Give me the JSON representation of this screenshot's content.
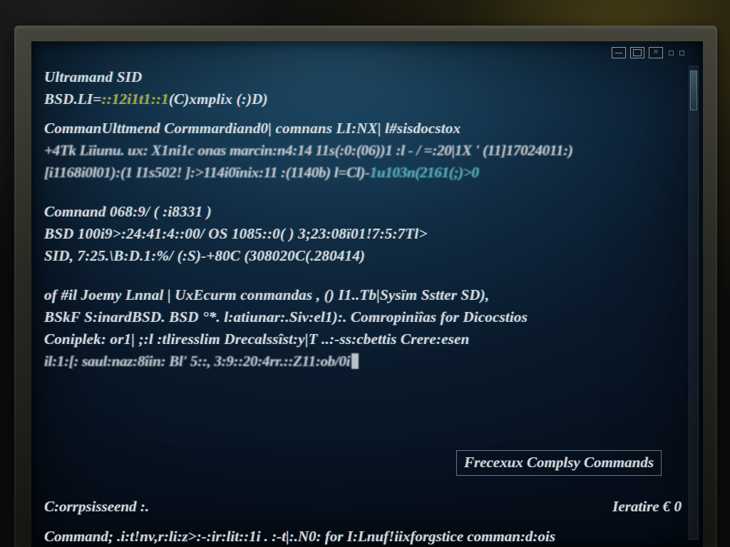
{
  "title": "Ultramand SID",
  "lines": {
    "l0": "Ultramand SID",
    "l1a": "BSD.LI=",
    "l1b": "::12i1t1::1",
    "l1c": "(C)xmplix (:)D)",
    "l2": "CommanUlttmend Cormmardiand0|  comnans LI:NX|  l#sisdocstox",
    "l3": "+4Tk Lïiunu.  ux: X1ni1c onas marcin:n4:14 11s(:0:(06))1 :l - / =:20|1X ' (11]17024011:)",
    "l4a": "[i1168i0l01):(1   I1s502! ]:>114i0ïnix:11 :(1140b) l=Cl)-",
    "l4b": "1u103n(2161(;)>0",
    "l5": "Comnand  068:9/  ( :i8331 )",
    "l6": "BSD 100i9>:24:41:4::00/ OS 1085::0( ) 3;23:08ï01!7:5:7Tl>",
    "l7": "SID,  7:25.\\B:D.1:%/  (:S)-+80C (308020C(.280414)",
    "l8": "of  #il Joemy Lnnal | UxEcurm conmandas , () I1..Tb|Sysïm Sstter  SD),",
    "l9": "  BSkF S:inardBSD. BSD °*. l:atiunar:.Siv:el1):. Comropiniîas for Dicocstios",
    "l10": "Coniplek: or1|  ;:l :tliresslim Drecalssîst:y|T ..:-ss:cbettis Crere:esen",
    "l11": "il:1:[: saul:naz:8îin:   Bl'   5::,   3:9::20:4rr.::Z11:ob/0i"
  },
  "boxed": "Frecexux Complsy Commands",
  "bottom_left": "C:orrpsisseend :.",
  "bottom_right": "Ieratire €  0",
  "lastline": "Command; .i:t!nv,r:li:z>:-:ir:lit::1i .  :-t|:.N0:  for I:Lnuf!iixforgstice  comman:d:ois"
}
